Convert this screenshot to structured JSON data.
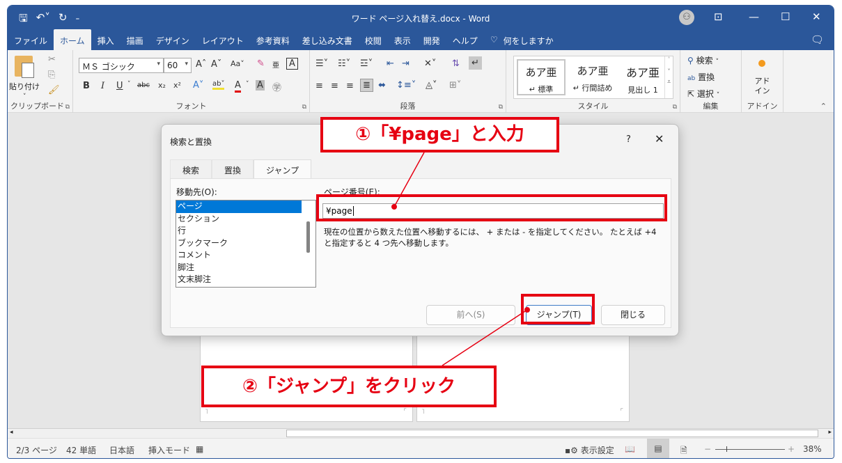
{
  "titlebar": {
    "title": "ワード ページ入れ替え.docx  -  Word",
    "qat_icons": [
      "save-icon",
      "undo-icon",
      "redo-icon",
      "customize-icon"
    ],
    "controls": [
      "ribbon-display-icon",
      "minimize-icon",
      "maximize-icon",
      "close-icon"
    ]
  },
  "tabs": [
    {
      "label": "ファイル"
    },
    {
      "label": "ホーム",
      "active": true
    },
    {
      "label": "挿入"
    },
    {
      "label": "描画"
    },
    {
      "label": "デザイン"
    },
    {
      "label": "レイアウト"
    },
    {
      "label": "参考資料"
    },
    {
      "label": "差し込み文書"
    },
    {
      "label": "校閲"
    },
    {
      "label": "表示"
    },
    {
      "label": "開発"
    },
    {
      "label": "ヘルプ"
    }
  ],
  "tell_me": "何をしますか",
  "ribbon": {
    "clipboard": {
      "paste_label": "貼り付け",
      "group_label": "クリップボード"
    },
    "font": {
      "font_name": "ＭＳ ゴシック",
      "font_size": "60",
      "group_label": "フォント"
    },
    "paragraph": {
      "group_label": "段落"
    },
    "styles": {
      "items": [
        {
          "preview": "あア亜",
          "name": "↵ 標準"
        },
        {
          "preview": "あア亜",
          "name": "↵ 行間詰め"
        },
        {
          "preview": "あア亜",
          "name": "見出し 1"
        }
      ],
      "group_label": "スタイル"
    },
    "editing": {
      "find": "検索",
      "replace": "置換",
      "select": "選択",
      "group_label": "編集"
    },
    "addins": {
      "label": "アド\nイン",
      "group_label": "アドイン"
    }
  },
  "dialog": {
    "title": "検索と置換",
    "help": "?",
    "tabs": [
      {
        "label": "検索"
      },
      {
        "label": "置換"
      },
      {
        "label": "ジャンプ",
        "active": true
      }
    ],
    "goto_label": "移動先(O):",
    "goto_items": [
      "ページ",
      "セクション",
      "行",
      "ブックマーク",
      "コメント",
      "脚注",
      "文末脚注"
    ],
    "goto_selected": "ページ",
    "page_number_label": "ページ番号(E):",
    "page_number_value": "¥page",
    "help_text": "現在の位置から数えた位置へ移動するには、 + または - を指定してください。 たとえば +4 と指定すると 4 つ先へ移動します。",
    "buttons": {
      "previous": "前へ(S)",
      "jump": "ジャンプ(T)",
      "close": "閉じる"
    }
  },
  "annotations": {
    "step1": "①「¥page」と入力",
    "step2": "②「ジャンプ」をクリック",
    "color": "#e60012"
  },
  "statusbar": {
    "page": "2/3 ページ",
    "words": "42 単語",
    "language": "日本語",
    "mode": "挿入モード",
    "display_settings": "表示設定",
    "zoom": "38%",
    "zoom_level_percent": 38
  },
  "colors": {
    "accent": "#2b579a",
    "selection": "#0078d7"
  }
}
